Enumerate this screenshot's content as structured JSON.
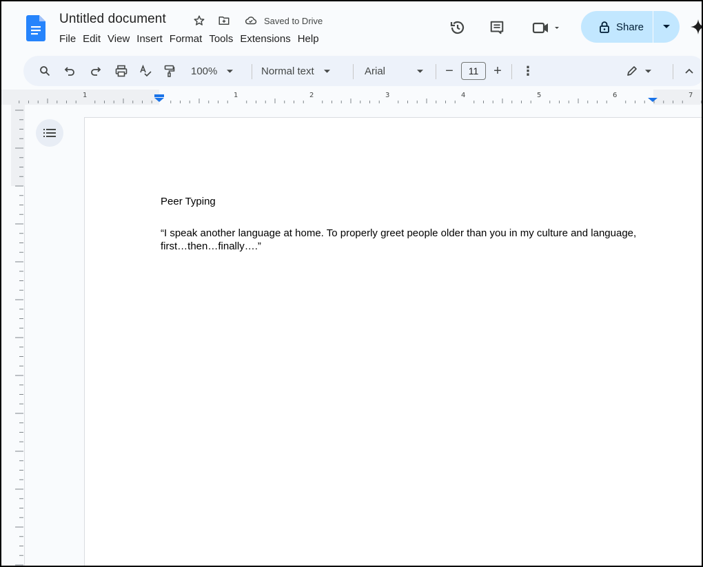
{
  "titlebar": {
    "doc_title": "Untitled document",
    "saved_status": "Saved to Drive",
    "menu": [
      "File",
      "Edit",
      "View",
      "Insert",
      "Format",
      "Tools",
      "Extensions",
      "Help"
    ],
    "share_label": "Share"
  },
  "toolbar": {
    "zoom": "100%",
    "style": "Normal text",
    "font": "Arial",
    "font_size": "11",
    "decrease_label": "−",
    "increase_label": "+",
    "more_label": "⋮"
  },
  "ruler": {
    "labels": [
      "1",
      "1",
      "2",
      "3",
      "4",
      "5",
      "6",
      "7"
    ]
  },
  "document": {
    "heading": "Peer Typing",
    "quote": "“I speak another language at home. To properly greet people older than you in my culture and language, first…then…finally….”"
  },
  "colors": {
    "accent": "#1a73e8",
    "share_bg": "#c2e7ff",
    "toolbar_bg": "#edf2fa",
    "app_bg": "#f9fbfd"
  },
  "icons": [
    "docs-logo-icon",
    "star-icon",
    "move-folder-icon",
    "cloud-saved-icon",
    "history-icon",
    "comments-icon",
    "meet-icon",
    "lock-icon",
    "gemini-icon",
    "search-icon",
    "undo-icon",
    "redo-icon",
    "print-icon",
    "spellcheck-icon",
    "paint-format-icon",
    "pencil-icon",
    "chevron-up-icon",
    "outline-icon"
  ]
}
